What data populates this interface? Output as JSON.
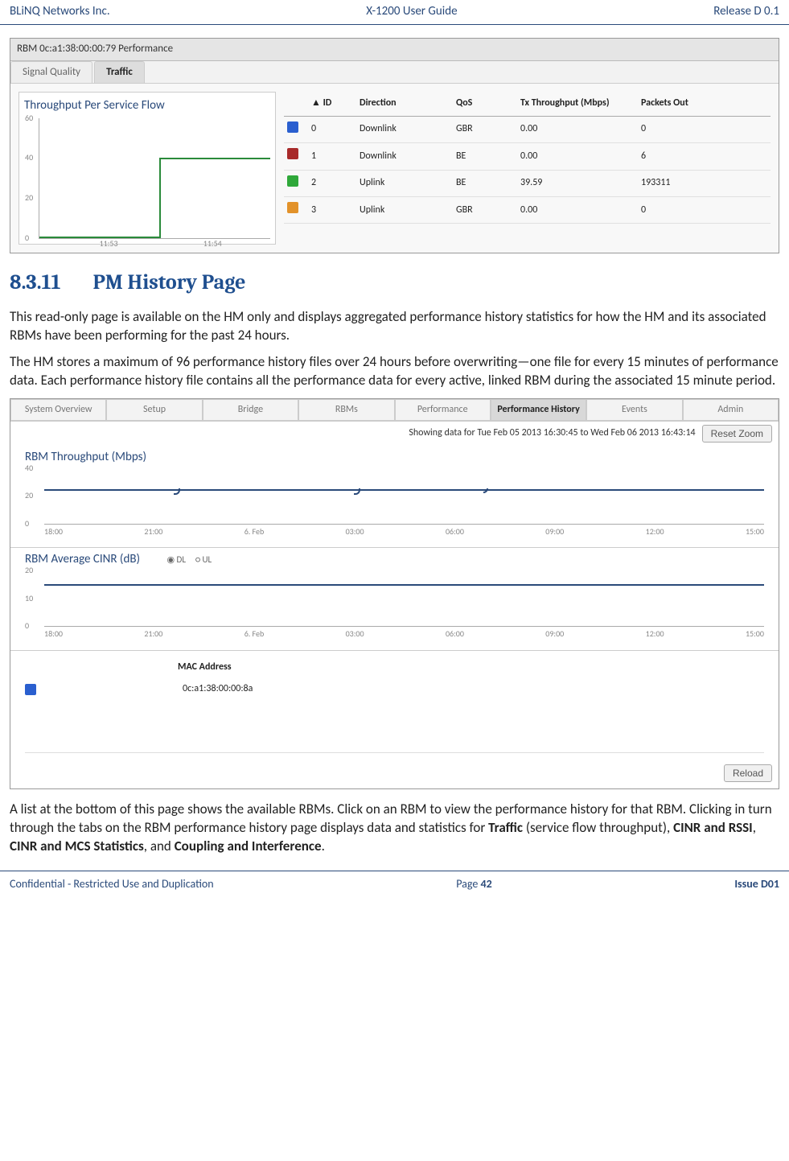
{
  "header": {
    "company": "BLiNQ Networks Inc.",
    "doc_title": "X-1200 User Guide",
    "release": "Release D 0.1"
  },
  "perf_panel": {
    "title": "RBM 0c:a1:38:00:00:79 Performance",
    "tabs": {
      "signal": "Signal Quality",
      "traffic": "Traffic"
    },
    "chart_title": "Throughput Per Service Flow",
    "columns": {
      "id": "▲ ID",
      "direction": "Direction",
      "qos": "QoS",
      "tx": "Tx Throughput (Mbps)",
      "packets": "Packets Out"
    },
    "rows": [
      {
        "swatch": "sw-blue",
        "id": "0",
        "dir": "Downlink",
        "qos": "GBR",
        "tx": "0.00",
        "pk": "0"
      },
      {
        "swatch": "sw-red",
        "id": "1",
        "dir": "Downlink",
        "qos": "BE",
        "tx": "0.00",
        "pk": "6"
      },
      {
        "swatch": "sw-green",
        "id": "2",
        "dir": "Uplink",
        "qos": "BE",
        "tx": "39.59",
        "pk": "193311"
      },
      {
        "swatch": "sw-orange",
        "id": "3",
        "dir": "Uplink",
        "qos": "GBR",
        "tx": "0.00",
        "pk": "0"
      }
    ]
  },
  "chart_data": [
    {
      "type": "line",
      "title": "Throughput Per Service Flow",
      "xlabel": "",
      "ylabel": "",
      "x_ticks": [
        "11:53",
        "11:54"
      ],
      "y_ticks": [
        0,
        20,
        40,
        60
      ],
      "ylim": [
        0,
        60
      ],
      "series": [
        {
          "name": "ID 2 Uplink BE",
          "color": "#2fa83a",
          "x": [
            "11:53",
            "11:54"
          ],
          "values": [
            0,
            40
          ]
        }
      ]
    },
    {
      "type": "line",
      "title": "RBM Throughput (Mbps)",
      "x_ticks": [
        "18:00",
        "21:00",
        "6. Feb",
        "03:00",
        "06:00",
        "09:00",
        "12:00",
        "15:00"
      ],
      "y_ticks": [
        0,
        20,
        40
      ],
      "ylim": [
        0,
        40
      ],
      "series": [
        {
          "name": "Throughput",
          "color": "#2a4a7a",
          "x": [
            "18:00",
            "21:00",
            "6. Feb",
            "03:00",
            "06:00",
            "09:00",
            "12:00",
            "15:00"
          ],
          "values": [
            22,
            20,
            22,
            21,
            22,
            21,
            22,
            22
          ]
        }
      ]
    },
    {
      "type": "line",
      "title": "RBM Average CINR (dB)",
      "x_ticks": [
        "18:00",
        "21:00",
        "6. Feb",
        "03:00",
        "06:00",
        "09:00",
        "12:00",
        "15:00"
      ],
      "y_ticks": [
        0,
        10,
        20
      ],
      "ylim": [
        0,
        20
      ],
      "series": [
        {
          "name": "DL",
          "color": "#2a4a7a",
          "x": [
            "18:00",
            "21:00",
            "6. Feb",
            "03:00",
            "06:00",
            "09:00",
            "12:00",
            "15:00"
          ],
          "values": [
            15,
            15,
            15,
            15,
            15,
            15,
            15,
            15
          ]
        }
      ]
    }
  ],
  "section": {
    "number": "8.3.11",
    "title": "PM History Page",
    "p1": "This read-only page is available on the HM only and displays aggregated performance history statistics for how the HM and its associated RBMs have been performing for the past 24 hours.",
    "p2": "The HM stores a maximum of 96 performance history files over 24 hours before overwriting—one file for every 15 minutes of performance data. Each performance history file contains all the performance data for every active, linked RBM during the associated 15 minute period.",
    "p3a": "A list at the bottom of this page shows the available RBMs. Click on an RBM to view the performance history for that RBM. Clicking in turn through the tabs on the RBM performance history page displays data and statistics for ",
    "p3b": " (service flow throughput), ",
    "p3c": ", ",
    "p3d": ", and ",
    "p3e": ".",
    "bold": {
      "traffic": "Traffic",
      "cinr_rssi": "CINR and RSSI",
      "cinr_mcs": "CINR and MCS Statistics",
      "coupling": "Coupling and Interference"
    }
  },
  "history": {
    "nav": [
      "System Overview",
      "Setup",
      "Bridge",
      "RBMs",
      "Performance",
      "Performance History",
      "Events",
      "Admin"
    ],
    "active_nav": "Performance History",
    "showing": "Showing data for Tue Feb 05 2013 16:30:45 to Wed Feb 06 2013 16:43:14",
    "reset_zoom": "Reset Zoom",
    "chart1_title": "RBM Throughput (Mbps)",
    "chart2_title": "RBM Average CINR (dB)",
    "radio": {
      "dl": "DL",
      "ul": "UL"
    },
    "y1": [
      "40",
      "20",
      "0"
    ],
    "y2": [
      "20",
      "10",
      "0"
    ],
    "x_ticks": [
      "18:00",
      "21:00",
      "6. Feb",
      "03:00",
      "06:00",
      "09:00",
      "12:00",
      "15:00"
    ],
    "list_header": "MAC Address",
    "list_item": "0c:a1:38:00:00:8a",
    "reload": "Reload"
  },
  "footer": {
    "left": "Confidential - Restricted Use and Duplication",
    "page_label": "Page ",
    "page_num": "42",
    "issue": "Issue D01"
  }
}
